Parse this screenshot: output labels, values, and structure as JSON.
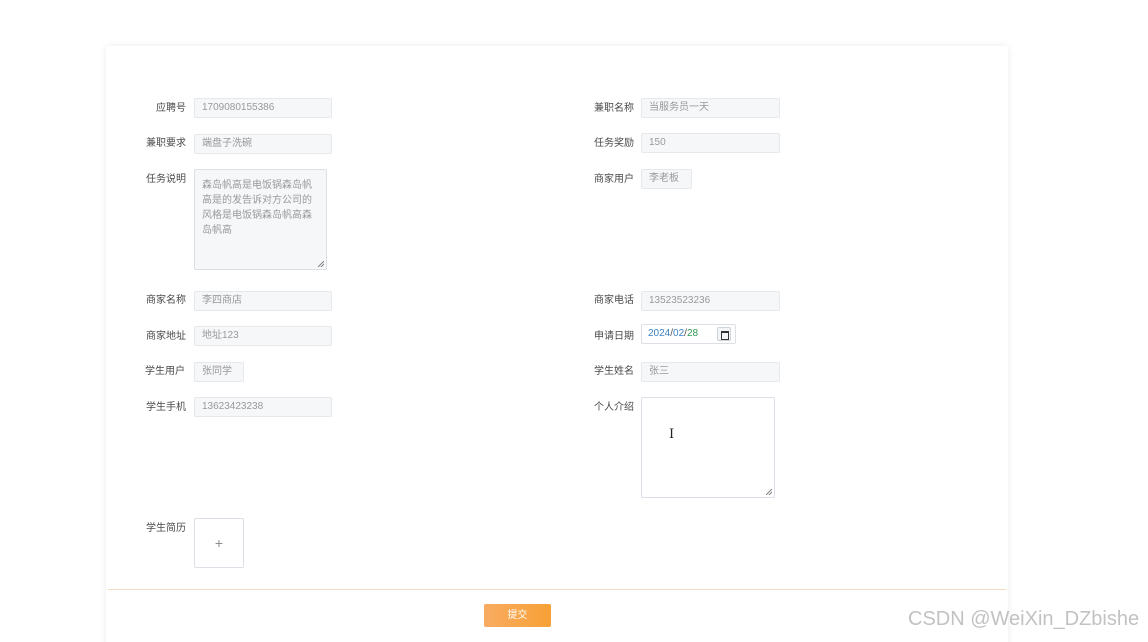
{
  "form": {
    "fields": {
      "application_no": {
        "label": "应聘号",
        "value": "1709080155386"
      },
      "job_name": {
        "label": "兼职名称",
        "value": "当服务员一天"
      },
      "requirement": {
        "label": "兼职要求",
        "value": "端盘子洗碗"
      },
      "reward": {
        "label": "任务奖励",
        "value": "150"
      },
      "task_description": {
        "label": "任务说明",
        "value": "森岛帆高是电饭锅森岛帆高是的发告诉对方公司的风格是电饭锅森岛帆高森岛帆高"
      },
      "merchant_user": {
        "label": "商家用户",
        "value": "李老板"
      },
      "merchant_name": {
        "label": "商家名称",
        "value": "李四商店"
      },
      "merchant_phone": {
        "label": "商家电话",
        "value": "13523523236"
      },
      "merchant_address": {
        "label": "商家地址",
        "value": "地址123"
      },
      "apply_date": {
        "label": "申请日期",
        "year": "2024",
        "month": "02",
        "day": "28",
        "sep": "/"
      },
      "student_user": {
        "label": "学生用户",
        "value": "张同学"
      },
      "student_name": {
        "label": "学生姓名",
        "value": "张三"
      },
      "student_phone": {
        "label": "学生手机",
        "value": "13623423238"
      },
      "intro": {
        "label": "个人介绍",
        "value": ""
      },
      "resume": {
        "label": "学生简历",
        "upload_symbol": "+"
      }
    },
    "submit_label": "提交",
    "submit_color": "#f7a135"
  },
  "cursor_glyph": "I",
  "watermark": "CSDN @WeiXin_DZbishe",
  "icons": {
    "calendar": "calendar-icon",
    "upload": "plus-icon"
  }
}
